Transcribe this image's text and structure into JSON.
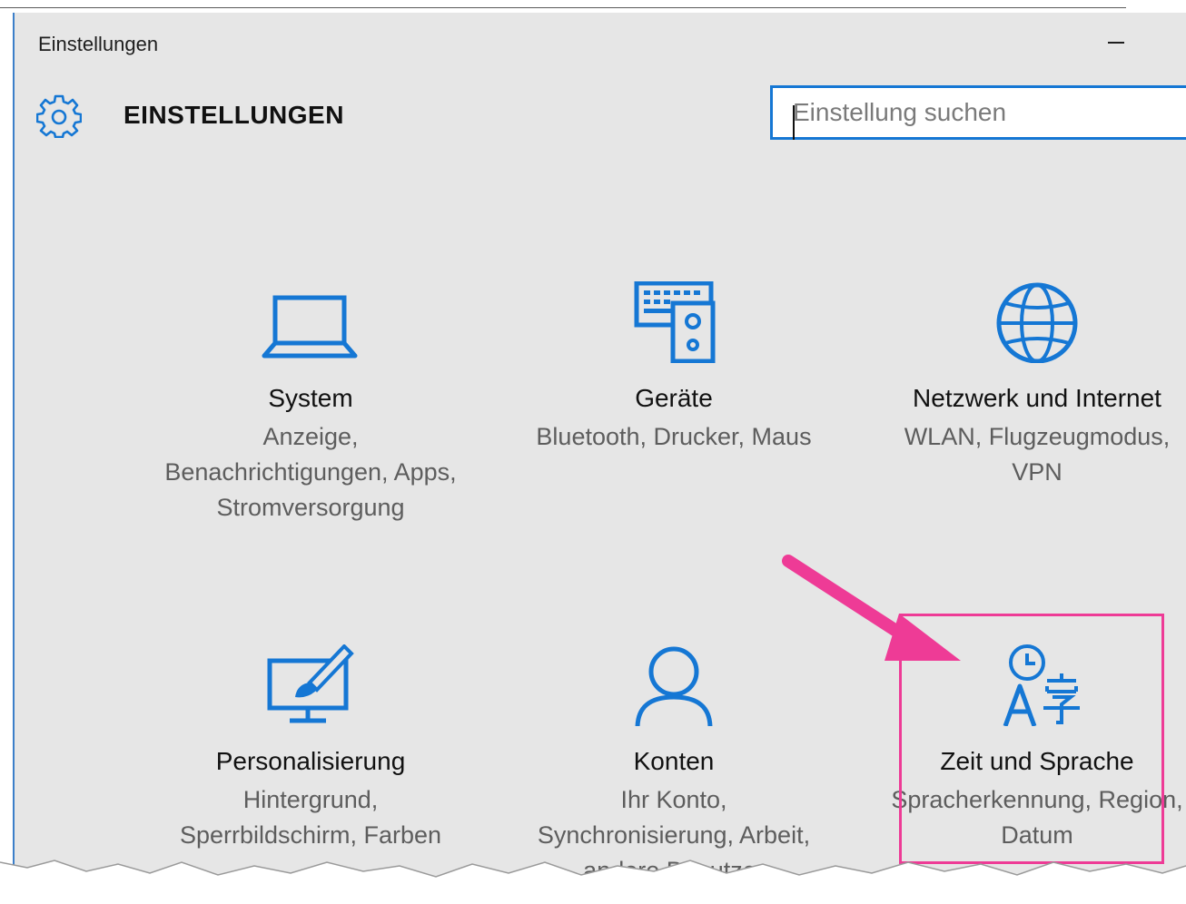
{
  "window": {
    "title": "Einstellungen"
  },
  "header": {
    "title": "EINSTELLUNGEN"
  },
  "search": {
    "placeholder": "Einstellung suchen",
    "value": ""
  },
  "tiles": [
    {
      "title": "System",
      "desc": "Anzeige, Benachrichtigungen, Apps, Stromversorgung",
      "icon": "laptop-icon"
    },
    {
      "title": "Geräte",
      "desc": "Bluetooth, Drucker, Maus",
      "icon": "devices-icon"
    },
    {
      "title": "Netzwerk und Internet",
      "desc": "WLAN, Flugzeugmodus, VPN",
      "icon": "globe-icon"
    },
    {
      "title": "Personalisierung",
      "desc": "Hintergrund, Sperrbildschirm, Farben",
      "icon": "personalization-icon"
    },
    {
      "title": "Konten",
      "desc": "Ihr Konto, Synchronisierung, Arbeit, andere Benutzer",
      "icon": "person-icon"
    },
    {
      "title": "Zeit und Sprache",
      "desc": "Spracherkennung, Region, Datum",
      "icon": "time-language-icon"
    }
  ],
  "colors": {
    "accent": "#1577d4",
    "highlight": "#ee3b96",
    "background": "#e6e6e6"
  }
}
